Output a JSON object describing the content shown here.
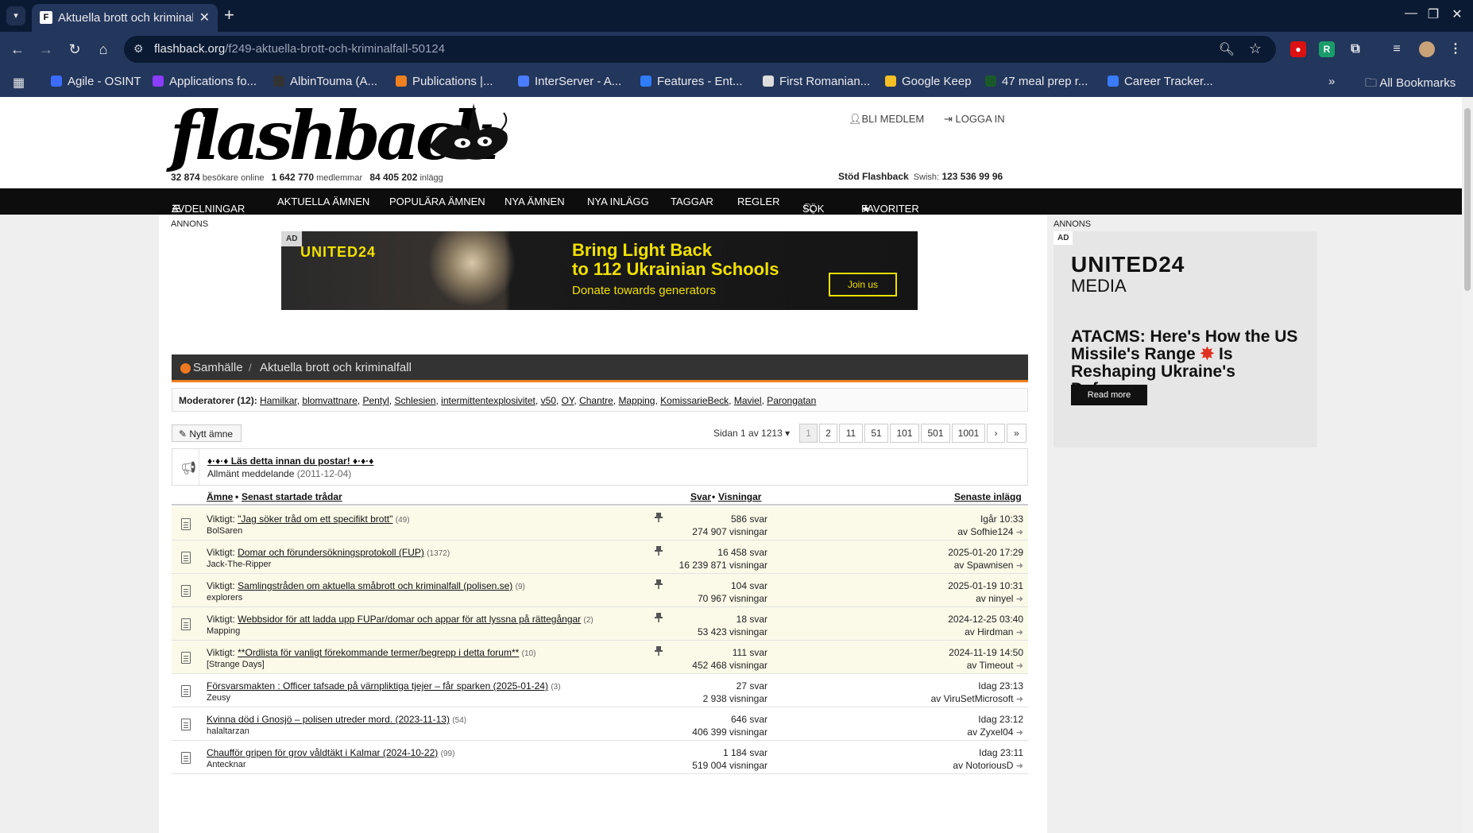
{
  "browser": {
    "tab_title": "Aktuella brott och kriminalfall",
    "url_host": "flashback.org",
    "url_path": "/f249-aktuella-brott-och-kriminalfall-50124",
    "bookmarks": [
      {
        "label": "Agile - OSINT",
        "color": "#3b6cff"
      },
      {
        "label": "Applications fo...",
        "color": "#8a3cff"
      },
      {
        "label": "AlbinTouma (A...",
        "color": "#333333"
      },
      {
        "label": "Publications |...",
        "color": "#f08020"
      },
      {
        "label": "InterServer - A...",
        "color": "#4a7cff"
      },
      {
        "label": "Features - Ent...",
        "color": "#2f7cff"
      },
      {
        "label": "First Romanian...",
        "color": "#dddddd"
      },
      {
        "label": "Google Keep",
        "color": "#f6c026"
      },
      {
        "label": "47 meal prep r...",
        "color": "#1a5a2a"
      },
      {
        "label": "Career Tracker...",
        "color": "#3a7cff"
      }
    ],
    "all_bookmarks": "All Bookmarks"
  },
  "header": {
    "logo": "flashback",
    "online": "32 874",
    "online_label": "besökare online",
    "members": "1 642 770",
    "members_label": "medlemmar",
    "posts": "84 405 202",
    "posts_label": "inlägg",
    "join": "BLI MEDLEM",
    "login": "LOGGA IN",
    "support": "Stöd Flashback",
    "swish_label": "Swish:",
    "swish": "123 536 99 96"
  },
  "nav": [
    "AVDELNINGAR",
    "AKTUELLA ÄMNEN",
    "POPULÄRA ÄMNEN",
    "NYA ÄMNEN",
    "NYA INLÄGG",
    "TAGGAR",
    "REGLER",
    "SÖK",
    "FAVORITER"
  ],
  "ads": {
    "label": "ANNONS",
    "tag": "AD",
    "banner_brand": "UNITED24",
    "banner_line1": "Bring Light Back",
    "banner_line2": "to 112 Ukrainian Schools",
    "banner_sub": "Donate towards generators",
    "banner_cta": "Join us",
    "side_brand": "UNITED24",
    "side_media": "MEDIA",
    "side_headline_a": "ATACMS: Here's How the US Missile's Range",
    "side_headline_b": "Is Reshaping Ukraine's Defence",
    "side_cta": "Read more"
  },
  "breadcrumb": {
    "parent": "Samhälle",
    "sep": "/",
    "current": "Aktuella brott och kriminalfall"
  },
  "moderators": {
    "label": "Moderatorer (12):",
    "names": [
      "Hamilkar",
      "blomvattnare",
      "Pentyl",
      "Schlesien",
      "intermittentexplosivitet",
      "v50",
      "OY",
      "Chantre",
      "Mapping",
      "KomissarieBeck",
      "Maviel",
      "Parongatan"
    ]
  },
  "toolbar": {
    "new_topic": "Nytt ämne",
    "page_label": "Sidan 1 av 1213",
    "pages": [
      "1",
      "2",
      "11",
      "51",
      "101",
      "501",
      "1001",
      "›",
      "»"
    ]
  },
  "announcement": {
    "title": "♦·♦·♦ Läs detta innan du postar! ♦·♦·♦",
    "sub": "Allmänt meddelande",
    "date": "(2011-12-04)"
  },
  "table": {
    "h_topic": "Ämne",
    "h_sep": "•",
    "h_recent": "Senast startade trådar",
    "h_replies": "Svar",
    "h_views": "Visningar",
    "h_last": "Senaste inlägg",
    "rows": [
      {
        "prefix": "Viktigt: ",
        "title": "\"Jag söker tråd om ett specifikt brott\"",
        "count": "(49)",
        "author": "BolSaren",
        "replies": "586 svar",
        "views": "274 907 visningar",
        "date": "Igår 10:33",
        "by": "av Sofhie124",
        "sticky": "yes"
      },
      {
        "prefix": "Viktigt: ",
        "title": "Domar och förundersökningsprotokoll (FUP)",
        "count": "(1372)",
        "author": "Jack-The-Ripper",
        "replies": "16 458 svar",
        "views": "16 239 871 visningar",
        "date": "2025-01-20 17:29",
        "by": "av Spawnisen",
        "sticky": "yes"
      },
      {
        "prefix": "Viktigt: ",
        "title": "Samlingstråden om aktuella småbrott och kriminalfall (polisen.se)",
        "count": "(9)",
        "author": "explorers",
        "replies": "104 svar",
        "views": "70 967 visningar",
        "date": "2025-01-19 10:31",
        "by": "av ninyel",
        "sticky": "yes"
      },
      {
        "prefix": "Viktigt: ",
        "title": "Webbsidor för att ladda upp FUPar/domar och appar för att lyssna på rättegångar",
        "count": "(2)",
        "author": "Mapping",
        "replies": "18 svar",
        "views": "53 423 visningar",
        "date": "2024-12-25 03:40",
        "by": "av Hirdman",
        "sticky": "yes"
      },
      {
        "prefix": "Viktigt: ",
        "title": "**Ordlista för vanligt förekommande termer/begrepp i detta forum**",
        "count": "(10)",
        "author": "[Strange Days]",
        "replies": "111 svar",
        "views": "452 468 visningar",
        "date": "2024-11-19 14:50",
        "by": "av Timeout",
        "sticky": "yes"
      },
      {
        "prefix": "",
        "title": "Försvarsmakten : Officer tafsade på värnpliktiga tjejer – får sparken (2025-01-24)",
        "count": "(3)",
        "author": "Zeusy",
        "replies": "27 svar",
        "views": "2 938 visningar",
        "date": "Idag 23:13",
        "by": "av ViruSetMicrosoft",
        "sticky": "no"
      },
      {
        "prefix": "",
        "title": "Kvinna död i Gnosjö – polisen utreder mord. (2023-11-13)",
        "count": "(54)",
        "author": "halaltarzan",
        "replies": "646 svar",
        "views": "406 399 visningar",
        "date": "Idag 23:12",
        "by": "av Zyxel04",
        "sticky": "no"
      },
      {
        "prefix": "",
        "title": "Chaufför gripen för grov våldtäkt i Kalmar (2024-10-22)",
        "count": "(99)",
        "author": "Antecknar",
        "replies": "1 184 svar",
        "views": "519 004 visningar",
        "date": "Idag 23:11",
        "by": "av NotoriousD",
        "sticky": "no"
      }
    ]
  }
}
